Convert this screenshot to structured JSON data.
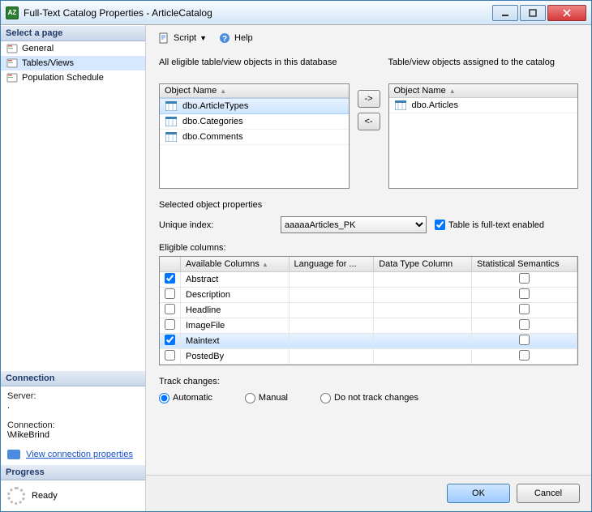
{
  "window": {
    "title": "Full-Text Catalog Properties - ArticleCatalog"
  },
  "sidebar": {
    "pageSection": "Select a page",
    "items": [
      {
        "label": "General"
      },
      {
        "label": "Tables/Views"
      },
      {
        "label": "Population Schedule"
      }
    ],
    "connectionSection": "Connection",
    "serverLabel": "Server:",
    "serverValue": ".",
    "connectionLabel": "Connection:",
    "connectionValue": "\\MikeBrind",
    "viewConnProps": "View connection properties",
    "progressSection": "Progress",
    "progressValue": "Ready"
  },
  "toolbar": {
    "script": "Script",
    "help": "Help"
  },
  "main": {
    "leftHead": "All eligible table/view objects in this database",
    "rightHead": "Table/view objects assigned to the catalog",
    "objectNameHdr": "Object Name",
    "leftItems": [
      "dbo.ArticleTypes",
      "dbo.Categories",
      "dbo.Comments"
    ],
    "rightItems": [
      "dbo.Articles"
    ],
    "moveRight": "->",
    "moveLeft": "<-",
    "selObjProps": "Selected object properties",
    "uniqueIndexLabel": "Unique index:",
    "uniqueIndexValue": "aaaaaArticles_PK",
    "ftEnabled": "Table is full-text enabled",
    "eligibleColumns": "Eligible columns:",
    "gridHeaders": {
      "avail": "Available Columns",
      "lang": "Language for ...",
      "dtype": "Data Type Column",
      "stats": "Statistical Semantics"
    },
    "columns": [
      {
        "name": "Abstract",
        "checked": true
      },
      {
        "name": "Description",
        "checked": false
      },
      {
        "name": "Headline",
        "checked": false
      },
      {
        "name": "ImageFile",
        "checked": false
      },
      {
        "name": "Maintext",
        "checked": true,
        "selected": true
      },
      {
        "name": "PostedBy",
        "checked": false
      }
    ],
    "trackChanges": "Track changes:",
    "radioAutomatic": "Automatic",
    "radioManual": "Manual",
    "radioNone": "Do not track changes"
  },
  "footer": {
    "ok": "OK",
    "cancel": "Cancel"
  }
}
